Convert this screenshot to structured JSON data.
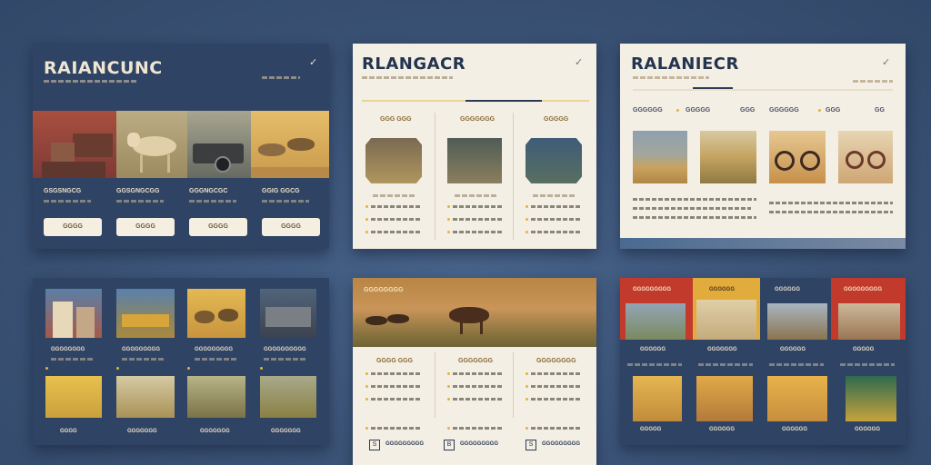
{
  "colors": {
    "background": "#3d5577",
    "dark_card": "#2f4364",
    "light_card": "#f3efe4",
    "accent_gold": "#e1b43a",
    "accent_red": "#c23a2c"
  },
  "card1": {
    "title": "RAIANCUNC",
    "icon": "check-icon",
    "items": [
      {
        "label": "GSGSNGCG",
        "button": "GGGG"
      },
      {
        "label": "GGSGNGCGG",
        "button": "GGGG"
      },
      {
        "label": "GGGNGCGC",
        "button": "GGGG"
      },
      {
        "label": "GGIG GGCG",
        "button": "GGGG"
      }
    ]
  },
  "card2": {
    "title": "RLANGACR",
    "icon": "check-icon",
    "columns": [
      {
        "label": "GGG GGG"
      },
      {
        "label": "GGGGGGG"
      },
      {
        "label": "GGGGG"
      }
    ]
  },
  "card3": {
    "title": "RALANIECR",
    "icon": "check-icon",
    "tabs": [
      "GGGGGG",
      "GGGGG",
      "GGG",
      "GGGGGG",
      "GGG",
      "GG"
    ]
  },
  "card4": {
    "row1": [
      "GGGGGGGG",
      "GGGGGGGGG",
      "GGGGGGGGG",
      "GGGGGGGGGG"
    ],
    "row2": [
      "GGGG",
      "GGGGGGG",
      "GGGGGGG",
      "GGGGGGG"
    ]
  },
  "card5": {
    "banner": "GGGGGGGG",
    "columns": [
      {
        "label": "GGGG GGG"
      },
      {
        "label": "GGGGGGG"
      },
      {
        "label": "GGGGGGGG"
      }
    ],
    "footer": [
      {
        "icon": "S",
        "label": "GGGGGGGGG"
      },
      {
        "icon": "B",
        "label": "GGGGGGGGG"
      },
      {
        "icon": "S",
        "label": "GGGGGGGGG"
      }
    ]
  },
  "card6": {
    "tabs": [
      "GGGGGGGGG",
      "GGGGGG",
      "GGGGGG",
      "GGGGGGGGG"
    ],
    "labels": [
      "GGGGGG",
      "GGGGGGG",
      "GGGGGG",
      "GGGGG"
    ],
    "footer": [
      "GGGGG",
      "GGGGGG",
      "GGGGGG",
      "GGGGGG"
    ]
  }
}
